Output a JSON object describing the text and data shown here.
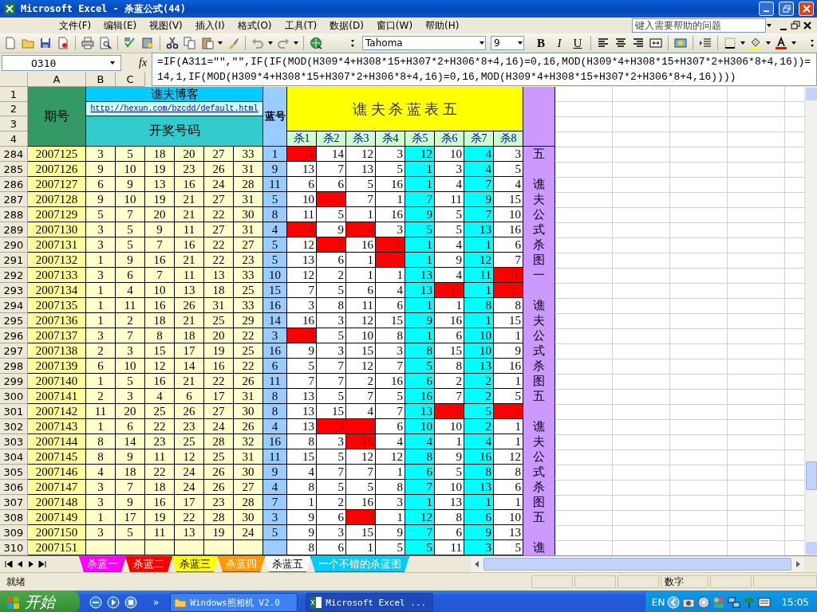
{
  "window": {
    "title": "Microsoft Excel - 杀蓝公式(44)"
  },
  "menu": [
    "文件(F)",
    "编辑(E)",
    "视图(V)",
    "插入(I)",
    "格式(O)",
    "工具(T)",
    "数据(D)",
    "窗口(W)",
    "帮助(H)"
  ],
  "help_box": {
    "placeholder": "键入需要帮助的问题"
  },
  "toolbar": {
    "font": "Tahoma",
    "size": "9",
    "format_buttons": [
      "B",
      "I",
      "U"
    ]
  },
  "formula_bar": {
    "name_box": "O310",
    "function_label": "fx",
    "formula": "=IF(A311=\"\",\"\",IF(IF(MOD(H309*4+H308*15+H307*2+H306*8+4,16)=0,16,MOD(H309*4+H308*15+H307*2+H306*8+4,16))=14,1,IF(MOD(H309*4+H308*15+H307*2+H306*8+4,16)=0,16,MOD(H309*4+H308*15+H307*2+H306*8+4,16))))"
  },
  "column_headers": [
    "A",
    "B",
    "C"
  ],
  "header_rows": [
    "1",
    "2",
    "3",
    "4"
  ],
  "sheet_header": {
    "period_label": "期号",
    "blog_title": "谯夫博客",
    "link": "http://hexun.com/bzcdd/default.html",
    "numbers_label": "开奖号码",
    "blue_label": "蓝号",
    "table_title": "谯 夫 杀 蓝 表 五",
    "kill_labels": [
      "杀1",
      "杀2",
      "杀3",
      "杀4",
      "杀5",
      "杀6",
      "杀7",
      "杀8"
    ]
  },
  "rows": [
    {
      "row": "284",
      "issue": "2007125",
      "balls": [
        "3",
        "5",
        "18",
        "20",
        "27",
        "33"
      ],
      "blue": "1",
      "kills": [
        "1",
        "14",
        "12",
        "3",
        "12",
        "10",
        "4",
        "3"
      ],
      "hits": [
        true,
        false,
        false,
        false,
        false,
        false,
        false,
        false
      ],
      "note": "五"
    },
    {
      "row": "285",
      "issue": "2007126",
      "balls": [
        "9",
        "10",
        "19",
        "23",
        "26",
        "31"
      ],
      "blue": "9",
      "kills": [
        "13",
        "7",
        "13",
        "5",
        "1",
        "3",
        "4",
        "5"
      ],
      "hits": [
        false,
        false,
        false,
        false,
        false,
        false,
        false,
        false
      ]
    },
    {
      "row": "286",
      "issue": "2007127",
      "balls": [
        "6",
        "9",
        "13",
        "16",
        "24",
        "28"
      ],
      "blue": "11",
      "kills": [
        "6",
        "6",
        "5",
        "16",
        "1",
        "4",
        "7",
        "4"
      ],
      "hits": [
        false,
        false,
        false,
        false,
        false,
        false,
        false,
        false
      ],
      "note": "谯"
    },
    {
      "row": "287",
      "issue": "2007128",
      "balls": [
        "9",
        "10",
        "19",
        "21",
        "27",
        "31"
      ],
      "blue": "5",
      "kills": [
        "10",
        "5",
        "7",
        "1",
        "7",
        "11",
        "9",
        "15"
      ],
      "hits": [
        false,
        true,
        false,
        false,
        false,
        false,
        false,
        false
      ],
      "note": "夫"
    },
    {
      "row": "288",
      "issue": "2007129",
      "balls": [
        "5",
        "7",
        "20",
        "21",
        "22",
        "30"
      ],
      "blue": "8",
      "kills": [
        "11",
        "5",
        "1",
        "16",
        "9",
        "5",
        "7",
        "10"
      ],
      "hits": [
        false,
        false,
        false,
        false,
        false,
        false,
        false,
        false
      ],
      "note": "公"
    },
    {
      "row": "289",
      "issue": "2007130",
      "balls": [
        "3",
        "5",
        "9",
        "11",
        "27",
        "31"
      ],
      "blue": "4",
      "kills": [
        "4",
        "9",
        "4",
        "3",
        "5",
        "5",
        "13",
        "16"
      ],
      "hits": [
        true,
        false,
        true,
        false,
        false,
        false,
        false,
        false
      ],
      "note": "式"
    },
    {
      "row": "290",
      "issue": "2007131",
      "balls": [
        "3",
        "5",
        "7",
        "16",
        "22",
        "27"
      ],
      "blue": "5",
      "kills": [
        "12",
        "5",
        "16",
        "5",
        "1",
        "4",
        "1",
        "6"
      ],
      "hits": [
        false,
        true,
        false,
        true,
        false,
        false,
        false,
        false
      ],
      "note": "杀"
    },
    {
      "row": "291",
      "issue": "2007132",
      "balls": [
        "1",
        "9",
        "16",
        "21",
        "22",
        "23"
      ],
      "blue": "5",
      "kills": [
        "13",
        "6",
        "1",
        "5",
        "1",
        "9",
        "12",
        "7"
      ],
      "hits": [
        false,
        false,
        false,
        true,
        false,
        false,
        false,
        false
      ],
      "note": "图"
    },
    {
      "row": "292",
      "issue": "2007133",
      "balls": [
        "3",
        "6",
        "7",
        "11",
        "13",
        "33"
      ],
      "blue": "10",
      "kills": [
        "12",
        "2",
        "1",
        "1",
        "13",
        "4",
        "11",
        "10"
      ],
      "hits": [
        false,
        false,
        false,
        false,
        false,
        false,
        false,
        true
      ],
      "note": "一"
    },
    {
      "row": "293",
      "issue": "2007134",
      "balls": [
        "1",
        "4",
        "10",
        "13",
        "18",
        "25"
      ],
      "blue": "15",
      "kills": [
        "7",
        "5",
        "6",
        "4",
        "13",
        "15",
        "1",
        "15"
      ],
      "hits": [
        false,
        false,
        false,
        false,
        false,
        true,
        false,
        true
      ]
    },
    {
      "row": "294",
      "issue": "2007135",
      "balls": [
        "1",
        "11",
        "16",
        "26",
        "31",
        "33"
      ],
      "blue": "16",
      "kills": [
        "3",
        "8",
        "11",
        "6",
        "1",
        "1",
        "8",
        "8"
      ],
      "hits": [
        false,
        false,
        false,
        false,
        false,
        false,
        false,
        false
      ],
      "note": "谯"
    },
    {
      "row": "295",
      "issue": "2007136",
      "balls": [
        "1",
        "2",
        "18",
        "21",
        "25",
        "29"
      ],
      "blue": "14",
      "kills": [
        "16",
        "3",
        "12",
        "15",
        "9",
        "16",
        "1",
        "15"
      ],
      "hits": [
        false,
        false,
        false,
        false,
        false,
        false,
        false,
        false
      ],
      "note": "夫"
    },
    {
      "row": "296",
      "issue": "2007137",
      "balls": [
        "3",
        "7",
        "8",
        "18",
        "20",
        "22"
      ],
      "blue": "3",
      "kills": [
        "3",
        "5",
        "10",
        "8",
        "1",
        "6",
        "10",
        "1"
      ],
      "hits": [
        true,
        false,
        false,
        false,
        false,
        false,
        false,
        false
      ],
      "note": "公"
    },
    {
      "row": "297",
      "issue": "2007138",
      "balls": [
        "2",
        "3",
        "15",
        "17",
        "19",
        "25"
      ],
      "blue": "16",
      "kills": [
        "9",
        "3",
        "15",
        "3",
        "8",
        "15",
        "10",
        "9"
      ],
      "hits": [
        false,
        false,
        false,
        false,
        false,
        false,
        false,
        false
      ],
      "note": "式"
    },
    {
      "row": "298",
      "issue": "2007139",
      "balls": [
        "6",
        "10",
        "12",
        "14",
        "16",
        "22"
      ],
      "blue": "6",
      "kills": [
        "5",
        "7",
        "12",
        "7",
        "5",
        "8",
        "13",
        "16"
      ],
      "hits": [
        false,
        false,
        false,
        false,
        false,
        false,
        false,
        false
      ],
      "note": "杀"
    },
    {
      "row": "299",
      "issue": "2007140",
      "balls": [
        "1",
        "5",
        "16",
        "21",
        "22",
        "26"
      ],
      "blue": "11",
      "kills": [
        "7",
        "7",
        "2",
        "16",
        "6",
        "2",
        "2",
        "1"
      ],
      "hits": [
        false,
        false,
        false,
        false,
        false,
        false,
        false,
        false
      ],
      "note": "图"
    },
    {
      "row": "300",
      "issue": "2007141",
      "balls": [
        "2",
        "3",
        "4",
        "6",
        "17",
        "31"
      ],
      "blue": "8",
      "kills": [
        "13",
        "5",
        "7",
        "5",
        "16",
        "7",
        "2",
        "5"
      ],
      "hits": [
        false,
        false,
        false,
        false,
        false,
        false,
        false,
        false
      ],
      "note": "五"
    },
    {
      "row": "301",
      "issue": "2007142",
      "balls": [
        "11",
        "20",
        "25",
        "26",
        "27",
        "30"
      ],
      "blue": "8",
      "kills": [
        "13",
        "15",
        "4",
        "7",
        "13",
        "8",
        "5",
        "8"
      ],
      "hits": [
        false,
        false,
        false,
        false,
        false,
        true,
        false,
        true
      ]
    },
    {
      "row": "302",
      "issue": "2007143",
      "balls": [
        "1",
        "6",
        "22",
        "23",
        "24",
        "26"
      ],
      "blue": "4",
      "kills": [
        "13",
        "4",
        "4",
        "6",
        "10",
        "10",
        "2",
        "1"
      ],
      "hits": [
        false,
        true,
        true,
        false,
        false,
        false,
        false,
        false
      ],
      "note": "谯"
    },
    {
      "row": "303",
      "issue": "2007144",
      "balls": [
        "8",
        "14",
        "23",
        "25",
        "28",
        "32"
      ],
      "blue": "16",
      "kills": [
        "8",
        "3",
        "16",
        "4",
        "4",
        "1",
        "4",
        "1"
      ],
      "hits": [
        false,
        false,
        true,
        false,
        false,
        false,
        false,
        false
      ],
      "note": "夫"
    },
    {
      "row": "304",
      "issue": "2007145",
      "balls": [
        "8",
        "9",
        "11",
        "12",
        "25",
        "31"
      ],
      "blue": "11",
      "kills": [
        "15",
        "5",
        "12",
        "12",
        "8",
        "9",
        "16",
        "12"
      ],
      "hits": [
        false,
        false,
        false,
        false,
        false,
        false,
        false,
        false
      ],
      "note": "公"
    },
    {
      "row": "305",
      "issue": "2007146",
      "balls": [
        "4",
        "18",
        "22",
        "24",
        "26",
        "30"
      ],
      "blue": "9",
      "kills": [
        "4",
        "7",
        "7",
        "1",
        "6",
        "5",
        "8",
        "8"
      ],
      "hits": [
        false,
        false,
        false,
        false,
        false,
        false,
        false,
        false
      ],
      "note": "式"
    },
    {
      "row": "306",
      "issue": "2007147",
      "balls": [
        "3",
        "7",
        "18",
        "24",
        "26",
        "27"
      ],
      "blue": "4",
      "kills": [
        "8",
        "5",
        "5",
        "8",
        "7",
        "10",
        "13",
        "6"
      ],
      "hits": [
        false,
        false,
        false,
        false,
        false,
        false,
        false,
        false
      ],
      "note": "杀"
    },
    {
      "row": "307",
      "issue": "2007148",
      "balls": [
        "3",
        "9",
        "16",
        "17",
        "23",
        "28"
      ],
      "blue": "7",
      "kills": [
        "1",
        "2",
        "16",
        "3",
        "1",
        "13",
        "1",
        "1"
      ],
      "hits": [
        false,
        false,
        false,
        false,
        false,
        false,
        false,
        false
      ],
      "note": "图"
    },
    {
      "row": "308",
      "issue": "2007149",
      "balls": [
        "1",
        "17",
        "19",
        "22",
        "28",
        "30"
      ],
      "blue": "3",
      "kills": [
        "9",
        "6",
        "3",
        "1",
        "12",
        "8",
        "6",
        "10"
      ],
      "hits": [
        false,
        false,
        true,
        false,
        false,
        false,
        false,
        false
      ],
      "note": "五"
    },
    {
      "row": "309",
      "issue": "2007150",
      "balls": [
        "3",
        "5",
        "11",
        "13",
        "19",
        "24"
      ],
      "blue": "5",
      "kills": [
        "9",
        "3",
        "15",
        "9",
        "7",
        "6",
        "9",
        "13"
      ],
      "hits": [
        false,
        false,
        false,
        false,
        false,
        false,
        false,
        false
      ]
    },
    {
      "row": "310",
      "issue": "2007151",
      "kills": [
        "8",
        "6",
        "1",
        "5",
        "5",
        "11",
        "3",
        "5"
      ],
      "hits": [
        false,
        false,
        false,
        false,
        false,
        false,
        false,
        false
      ],
      "note": "谯"
    }
  ],
  "sheet_tabs": [
    {
      "label": "杀蓝一",
      "color": "#ff00ff",
      "selected": false
    },
    {
      "label": "杀蓝二",
      "color": "#ff0000",
      "selected": false
    },
    {
      "label": "杀蓝三",
      "color": "#ffff00",
      "selected": false
    },
    {
      "label": "杀蓝四",
      "color": "#ff9900",
      "selected": false
    },
    {
      "label": "杀蓝五",
      "selected": true
    },
    {
      "label": "一个不错的杀蓝图",
      "color": "#00ccff",
      "selected": false
    }
  ],
  "status_bar": {
    "left": "就绪",
    "right": "数字"
  },
  "taskbar": {
    "start": "开始",
    "chevron": "»",
    "tasks": [
      {
        "label": "Windows照相机 V2.0",
        "selected": false
      },
      {
        "label": "Microsoft Excel ...",
        "selected": true
      }
    ],
    "language": "EN",
    "clock": "15:05"
  }
}
